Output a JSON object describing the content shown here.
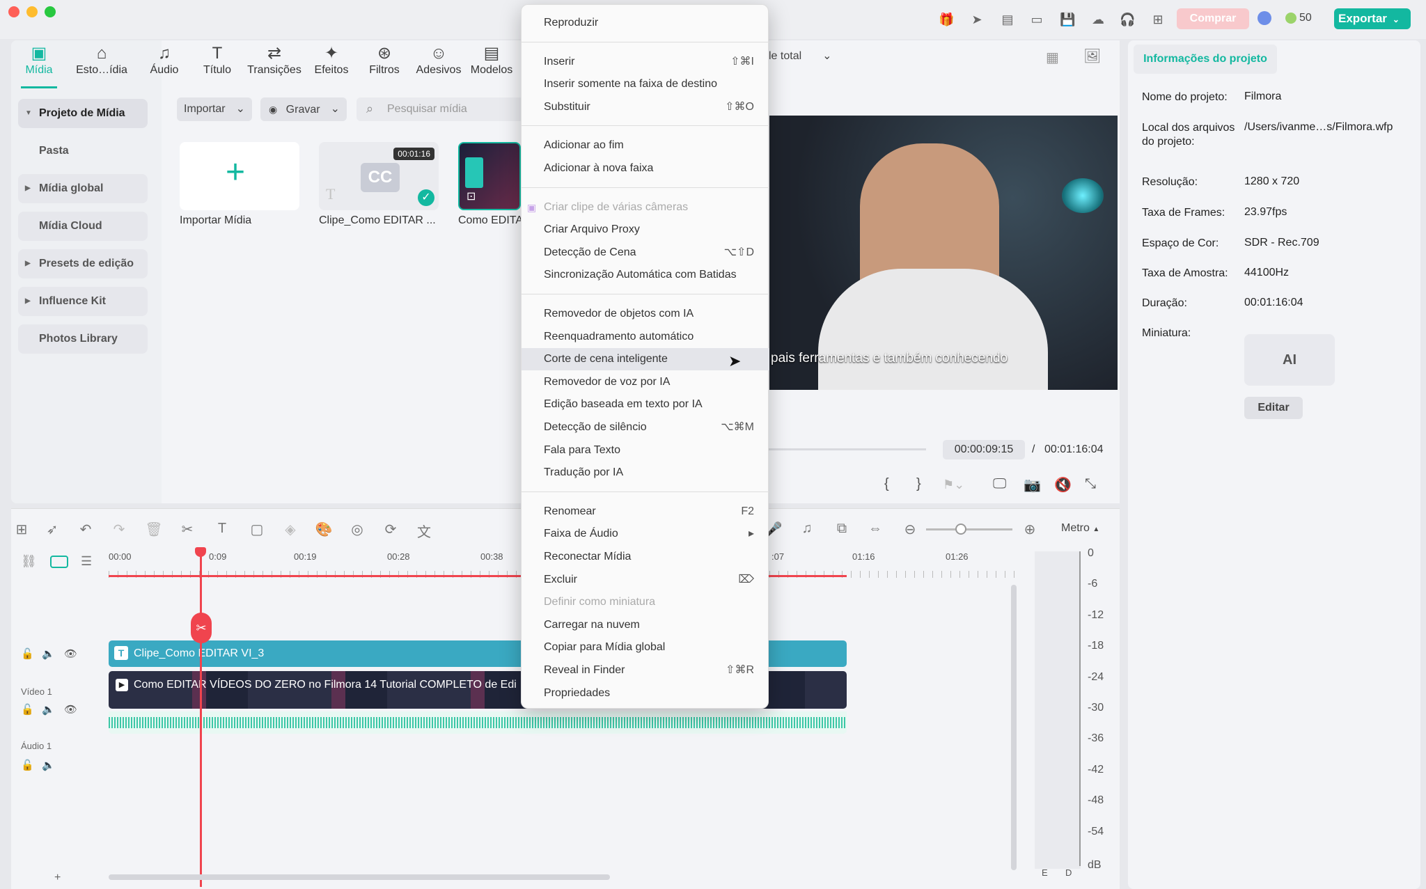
{
  "topbar": {
    "buy_label": "Comprar",
    "credits": "50",
    "export_label": "Exportar"
  },
  "media_tabs": [
    {
      "label": "Mídia",
      "icon": "media-icon"
    },
    {
      "label": "Esto…ídia",
      "icon": "stock-icon"
    },
    {
      "label": "Áudio",
      "icon": "music-note-icon"
    },
    {
      "label": "Título",
      "icon": "title-t-icon"
    },
    {
      "label": "Transições",
      "icon": "transition-icon"
    },
    {
      "label": "Efeitos",
      "icon": "effects-icon"
    },
    {
      "label": "Filtros",
      "icon": "filter-icon"
    },
    {
      "label": "Adesivos",
      "icon": "sticker-icon"
    },
    {
      "label": "Modelos",
      "icon": "template-icon"
    }
  ],
  "sidebar": [
    {
      "label": "Projeto de Mídia"
    },
    {
      "label": "Pasta"
    },
    {
      "label": "Mídia global"
    },
    {
      "label": "Mídia Cloud"
    },
    {
      "label": "Presets de edição"
    },
    {
      "label": "Influence Kit"
    },
    {
      "label": "Photos Library"
    }
  ],
  "media_toolbar": {
    "import_label": "Importar",
    "record_label": "Gravar",
    "search_placeholder": "Pesquisar mídia"
  },
  "media_items": [
    {
      "label": "Importar Mídia"
    },
    {
      "label": "Clipe_Como EDITAR ...",
      "duration": "00:01:16"
    },
    {
      "label": "Como EDITA"
    }
  ],
  "preview": {
    "zoom_label": "le total",
    "subtitle": "pais ferramentas e também conhecendo",
    "current_time": "00:00:09:15",
    "separator": "/",
    "total_time": "00:01:16:04"
  },
  "project_info": {
    "tab_label": "Informações do projeto",
    "rows": [
      {
        "key": "Nome do projeto:",
        "value": "Filmora"
      },
      {
        "key": "Local dos arquivos do projeto:",
        "value": "/Users/ivanme…s/Filmora.wfp"
      },
      {
        "key": "Resolução:",
        "value": "1280 x 720"
      },
      {
        "key": "Taxa de Frames:",
        "value": "23.97fps"
      },
      {
        "key": "Espaço de Cor:",
        "value": "SDR - Rec.709"
      },
      {
        "key": "Taxa de Amostra:",
        "value": "44100Hz"
      },
      {
        "key": "Duração:",
        "value": "00:01:16:04"
      },
      {
        "key": "Miniatura:",
        "value": ""
      }
    ],
    "thumb_text": "AI",
    "edit_label": "Editar"
  },
  "timeline": {
    "meter_label": "Metro",
    "ruler": [
      "00:00",
      "0:09",
      "00:19",
      "00:28",
      "00:38",
      ":07",
      "01:16",
      "01:26"
    ],
    "title_clip": "Clipe_Como EDITAR VI_3",
    "video_clip": "Como EDITAR VÍDEOS DO ZERO no Filmora 14 Tutorial COMPLETO de Edi",
    "video_track_label": "Vídeo 1",
    "audio_track_label": "Áudio 1",
    "add_label": "+",
    "meter_scale": [
      "0",
      "-6",
      "-12",
      "-18",
      "-24",
      "-30",
      "-36",
      "-42",
      "-48",
      "-54",
      "dB"
    ],
    "meter_channels": [
      "E",
      "D"
    ]
  },
  "context_menu": {
    "groups": [
      [
        {
          "label": "Reproduzir",
          "shortcut": ""
        }
      ],
      [
        {
          "label": "Inserir",
          "shortcut": "⇧⌘I"
        },
        {
          "label": "Inserir somente na faixa de destino",
          "shortcut": ""
        },
        {
          "label": "Substituir",
          "shortcut": "⇧⌘O"
        }
      ],
      [
        {
          "label": "Adicionar ao fim",
          "shortcut": ""
        },
        {
          "label": "Adicionar à nova faixa",
          "shortcut": ""
        }
      ],
      [
        {
          "label": "Criar clipe de várias câmeras",
          "shortcut": "",
          "disabled": true
        },
        {
          "label": "Criar Arquivo Proxy",
          "shortcut": ""
        },
        {
          "label": "Detecção de Cena",
          "shortcut": "⌥⇧D"
        },
        {
          "label": "Sincronização Automática com Batidas",
          "shortcut": ""
        }
      ],
      [
        {
          "label": "Removedor de objetos com IA",
          "shortcut": ""
        },
        {
          "label": "Reenquadramento automático",
          "shortcut": ""
        },
        {
          "label": "Corte de cena inteligente",
          "shortcut": "",
          "highlighted": true
        },
        {
          "label": "Removedor de voz por IA",
          "shortcut": ""
        },
        {
          "label": "Edição baseada em texto por IA",
          "shortcut": ""
        },
        {
          "label": "Detecção de silêncio",
          "shortcut": "⌥⌘M"
        },
        {
          "label": "Fala para Texto",
          "shortcut": ""
        },
        {
          "label": "Tradução por IA",
          "shortcut": ""
        }
      ],
      [
        {
          "label": "Renomear",
          "shortcut": "F2"
        },
        {
          "label": "Faixa de Áudio",
          "shortcut": "▸"
        },
        {
          "label": "Reconectar Mídia",
          "shortcut": ""
        },
        {
          "label": "Excluir",
          "shortcut": "⌦"
        },
        {
          "label": "Definir como miniatura",
          "shortcut": "",
          "disabled": true
        },
        {
          "label": "Carregar na nuvem",
          "shortcut": ""
        },
        {
          "label": "Copiar para Mídia global",
          "shortcut": ""
        },
        {
          "label": "Reveal in Finder",
          "shortcut": "⇧⌘R"
        },
        {
          "label": "Propriedades",
          "shortcut": ""
        }
      ]
    ]
  },
  "colors": {
    "accent": "#13b8a0",
    "playhead": "#f0444e",
    "title_clip": "#3aa9c2",
    "audio_wave": "#3cc7a6"
  }
}
